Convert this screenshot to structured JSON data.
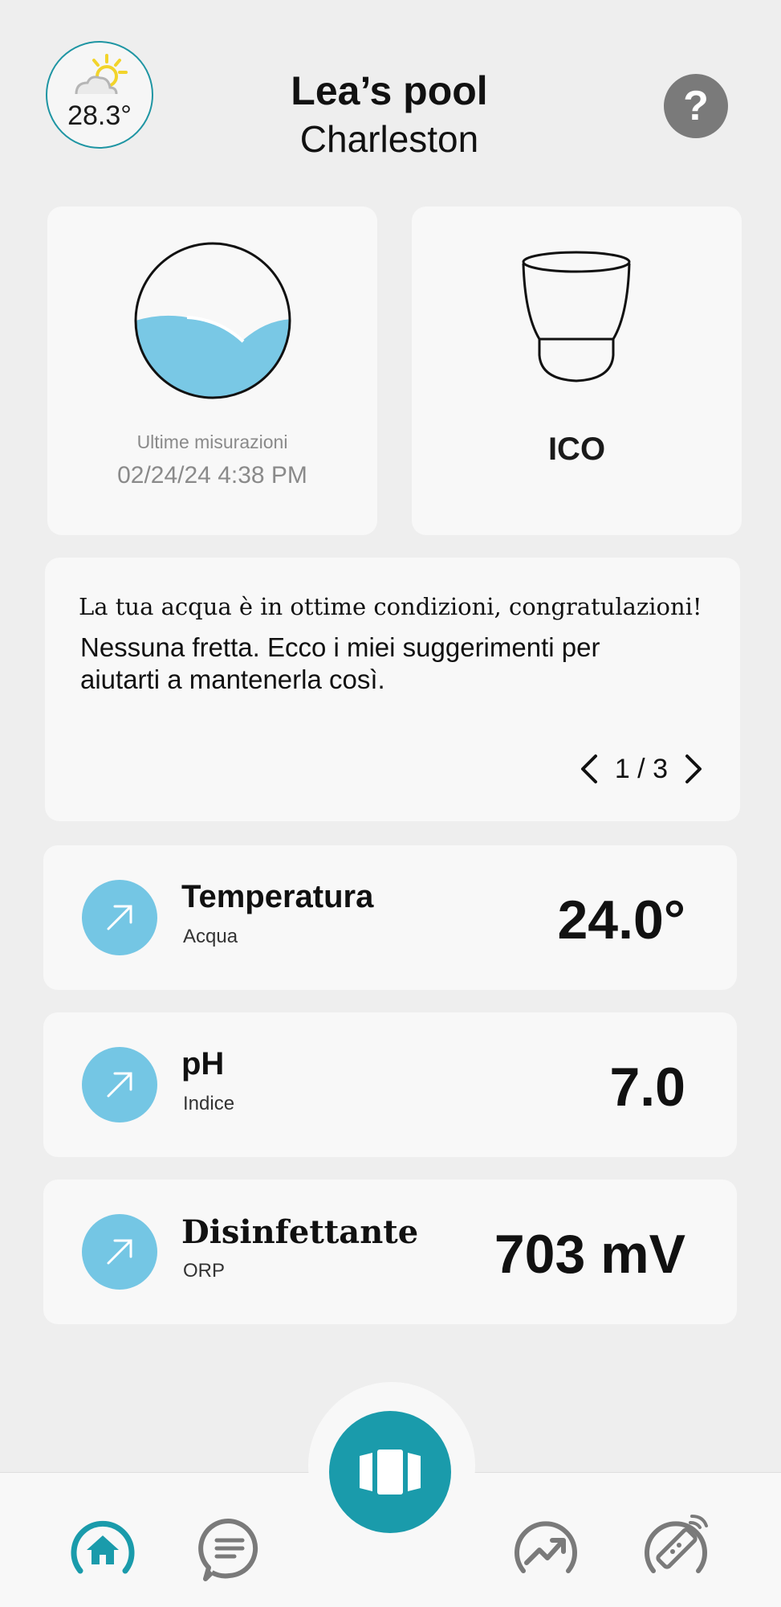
{
  "header": {
    "weather_temp": "28.3°",
    "pool_name": "Lea’s pool",
    "location": "Charleston",
    "help_label": "?"
  },
  "water_card": {
    "label": "Ultime misurazioni",
    "date": "02/24/24 4:38 PM"
  },
  "device_card": {
    "label": "ICO"
  },
  "message_card": {
    "line1": "La tua acqua è in ottime condizioni, congratulazioni!",
    "line2": "Nessuna fretta. Ecco i miei suggerimenti per aiutarti a mantenerla così.",
    "pager": "1 / 3"
  },
  "metrics": [
    {
      "name": "Temperatura",
      "sub": "Acqua",
      "value": "24.0°"
    },
    {
      "name": "pH",
      "sub": "Indice",
      "value": "7.0"
    },
    {
      "name": "Disinfettante",
      "sub": "ORP",
      "value": "703 mV"
    }
  ],
  "colors": {
    "accent": "#1a9bab",
    "badge": "#74c6e4",
    "water": "#79c8e5",
    "background": "#eeeeee"
  },
  "icons": {
    "weather": "partly-sunny-icon",
    "help": "question-icon",
    "trend": "arrow-up-right-icon",
    "nav": [
      "home-icon",
      "chat-icon",
      "stats-icon",
      "remote-icon"
    ],
    "fab": "device-icon"
  }
}
